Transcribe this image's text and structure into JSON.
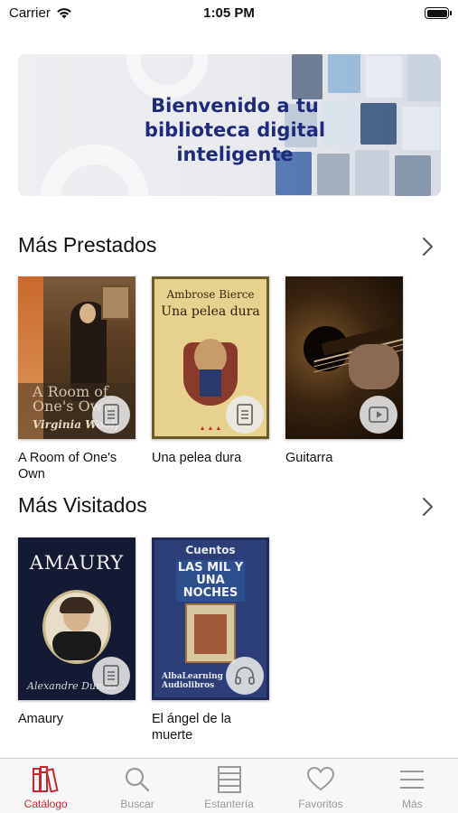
{
  "status_bar": {
    "carrier": "Carrier",
    "time": "1:05 PM"
  },
  "banner": {
    "line1": "Bienvenido a tu",
    "line2": "biblioteca digital inteligente"
  },
  "sections": [
    {
      "title": "Más Prestados",
      "books": [
        {
          "title": "A Room of One's Own",
          "cover_text": "A Room of One's Own",
          "cover_author": "Virginia Woolf",
          "format": "document-icon"
        },
        {
          "title": "Una pelea dura",
          "cover_text": "Una pelea dura",
          "cover_author": "Ambrose Bierce",
          "format": "document-icon"
        },
        {
          "title": "Guitarra",
          "cover_text": "",
          "cover_author": "",
          "format": "video-icon"
        }
      ]
    },
    {
      "title": "Más Visitados",
      "books": [
        {
          "title": "Amaury",
          "cover_text": "Amaury",
          "cover_author": "Alexandre Dumas",
          "format": "document-icon"
        },
        {
          "title": "El ángel de la muerte",
          "cover_text": "Las mil y una noches",
          "cover_kicker": "Cuentos",
          "cover_author": "AlbaLearning Audiolibros",
          "format": "headphones-icon"
        }
      ]
    }
  ],
  "tab_bar": [
    {
      "label": "Catálogo",
      "icon": "books-icon",
      "active": true
    },
    {
      "label": "Buscar",
      "icon": "search-icon",
      "active": false
    },
    {
      "label": "Estantería",
      "icon": "shelf-icon",
      "active": false
    },
    {
      "label": "Favoritos",
      "icon": "heart-icon",
      "active": false
    },
    {
      "label": "Más",
      "icon": "menu-icon",
      "active": false
    }
  ],
  "colors": {
    "accent": "#c8282c",
    "banner_text": "#1e2a7a",
    "inactive_tab": "#9a9a9a"
  }
}
